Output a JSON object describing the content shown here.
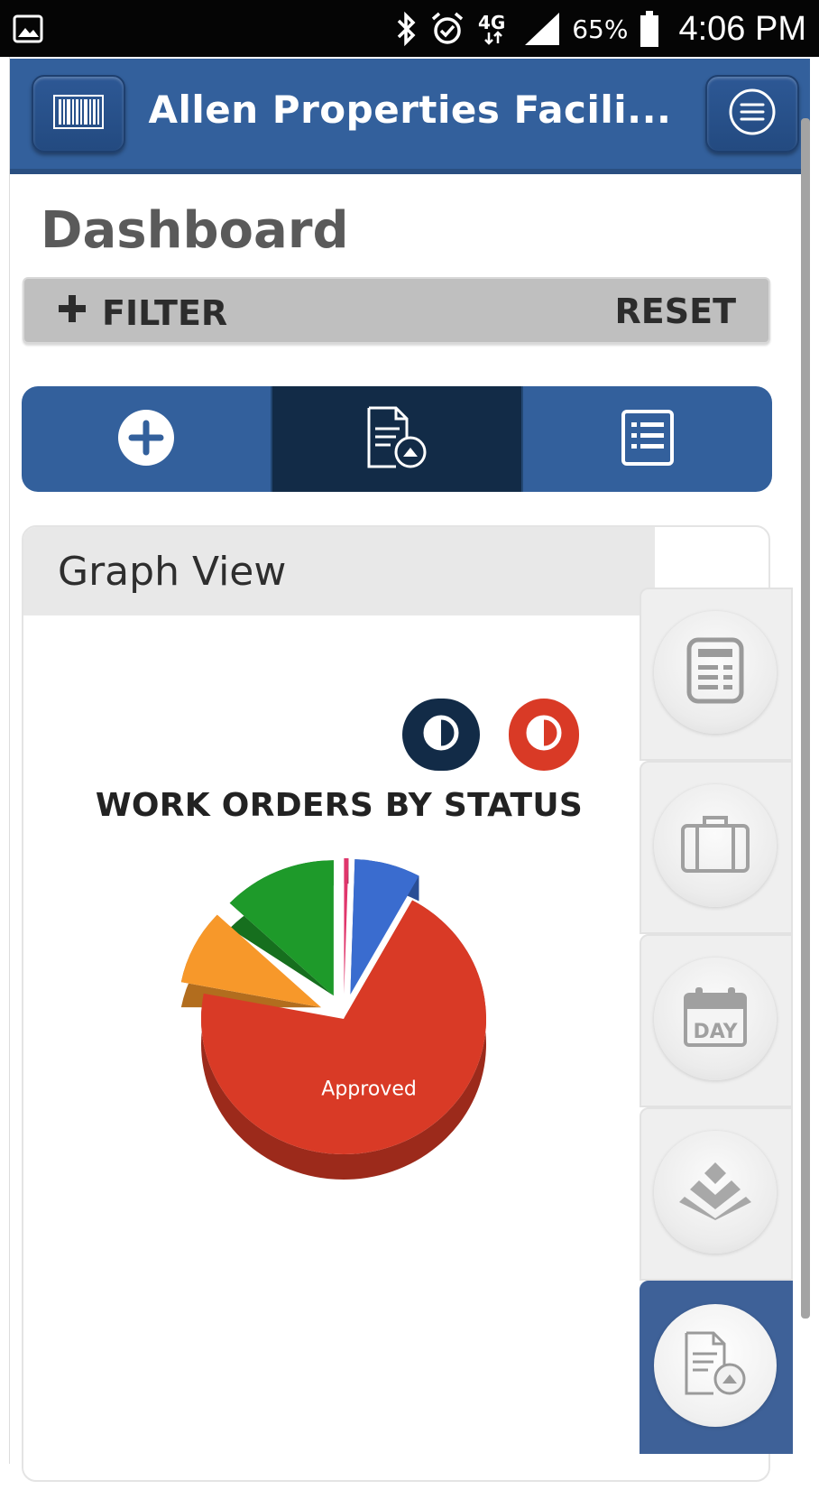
{
  "status_bar": {
    "battery": "65%",
    "time": "4:06 PM",
    "icons": [
      "gallery-icon",
      "bluetooth-icon",
      "alarm-icon",
      "4g-lte-icon",
      "signal-icon",
      "battery-icon"
    ]
  },
  "header": {
    "title": "Allen Properties Facili...",
    "left_icon": "barcode-icon",
    "right_icon": "menu-icon"
  },
  "page": {
    "title": "Dashboard"
  },
  "filter": {
    "filter_label": "FILTER",
    "reset_label": "RESET"
  },
  "tabs": [
    {
      "icon": "plus-circle-icon",
      "active": false
    },
    {
      "icon": "document-clock-icon",
      "active": true
    },
    {
      "icon": "list-icon",
      "active": false
    }
  ],
  "card": {
    "title": "Graph View"
  },
  "side_rail": [
    {
      "icon": "receipt-icon",
      "active": false
    },
    {
      "icon": "briefcase-icon",
      "active": false
    },
    {
      "icon": "calendar-day-icon",
      "active": false
    },
    {
      "icon": "layers-icon",
      "active": false
    },
    {
      "icon": "document-clock-icon",
      "active": true
    }
  ],
  "calendar_icon_text": "DAY",
  "colors": {
    "header": "#33609c",
    "active_tab": "#122b47",
    "approved": "#d93a26"
  },
  "chart_data": {
    "type": "pie",
    "title": "WORK ORDERS BY STATUS",
    "slices": [
      {
        "label": "",
        "value": 0.5,
        "color": "#e0366c"
      },
      {
        "label": "",
        "value": 7.5,
        "color": "#3a6ccf"
      },
      {
        "label": "Approved",
        "value": 70,
        "color": "#d93a26"
      },
      {
        "label": "",
        "value": 9,
        "color": "#f7982a"
      },
      {
        "label": "",
        "value": 13,
        "color": "#1e9a2a"
      }
    ],
    "legend": "none"
  }
}
